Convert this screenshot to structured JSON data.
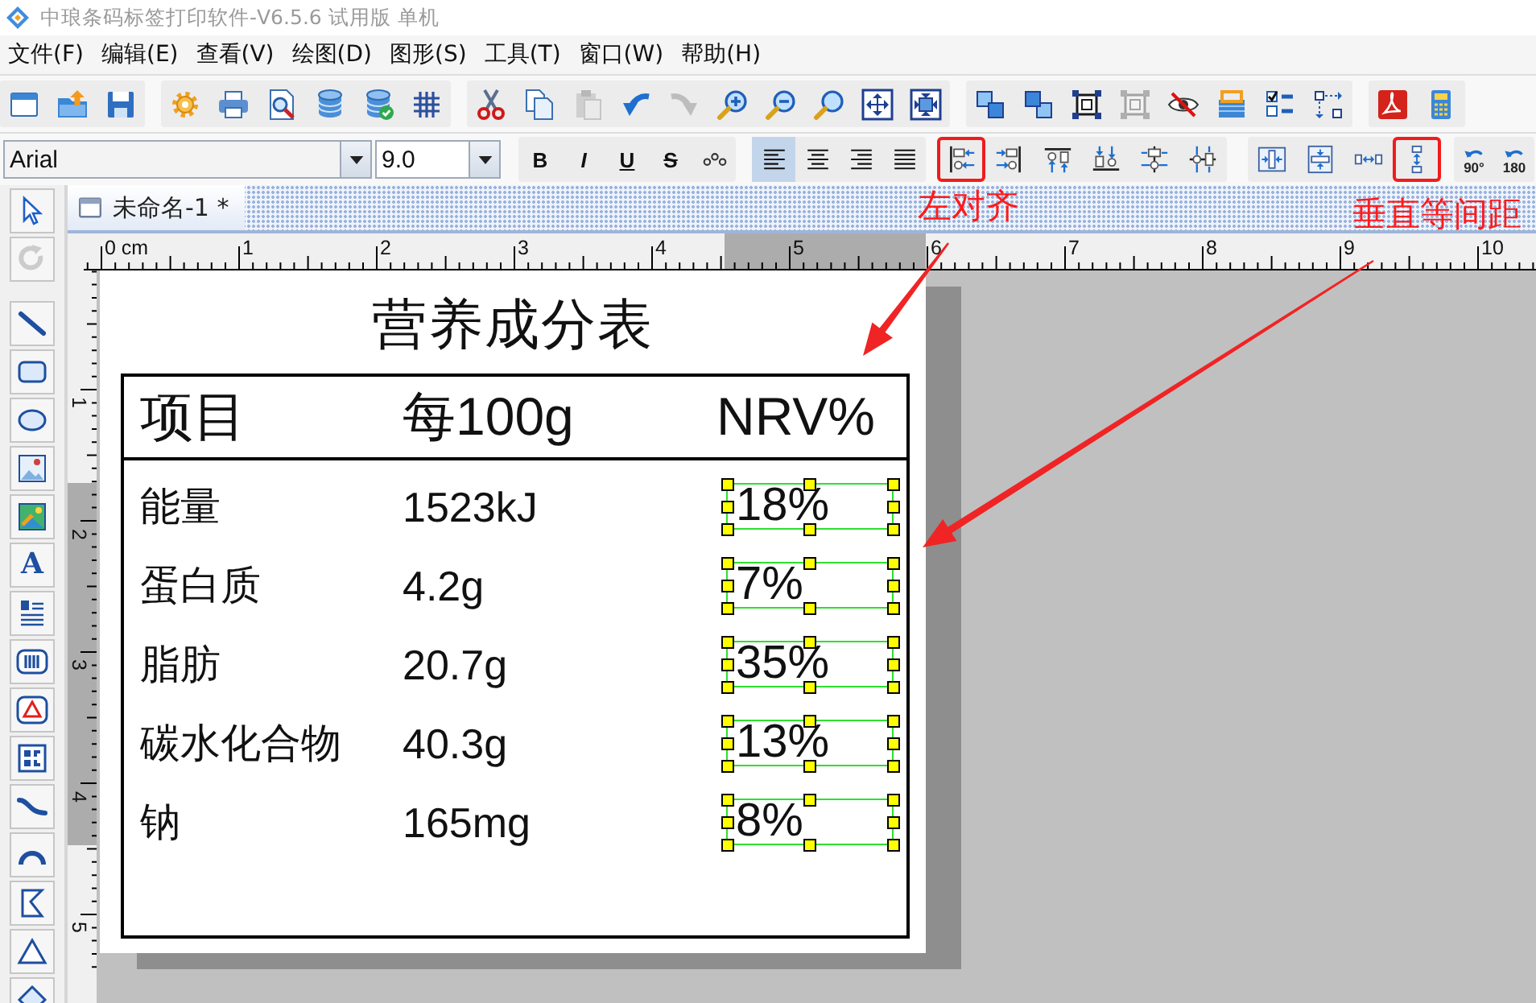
{
  "window": {
    "title": "中琅条码标签打印软件-V6.5.6 试用版 单机"
  },
  "menu": [
    "文件(F)",
    "编辑(E)",
    "查看(V)",
    "绘图(D)",
    "图形(S)",
    "工具(T)",
    "窗口(W)",
    "帮助(H)"
  ],
  "main_toolbar": {
    "groups": [
      [
        {
          "disabled": false
        },
        {
          "disabled": false
        },
        {
          "disabled": false
        }
      ],
      [
        {
          "disabled": false
        },
        {
          "disabled": false
        },
        {
          "disabled": false
        },
        {
          "disabled": false
        },
        {
          "disabled": false
        },
        {
          "disabled": false
        }
      ],
      [
        {
          "disabled": false
        },
        {
          "disabled": false
        },
        {
          "disabled": true
        },
        {
          "disabled": false
        },
        {
          "disabled": true
        },
        {
          "disabled": false
        },
        {
          "disabled": false
        },
        {
          "disabled": false
        },
        {
          "disabled": false
        },
        {
          "disabled": false
        }
      ],
      [
        {
          "disabled": false
        },
        {
          "disabled": false
        },
        {
          "disabled": false
        },
        {
          "disabled": true
        },
        {
          "disabled": false
        },
        {
          "disabled": false
        },
        {
          "disabled": false
        },
        {
          "disabled": false
        }
      ],
      [
        {
          "disabled": false
        },
        {
          "disabled": false
        }
      ]
    ]
  },
  "format_toolbar": {
    "font": "Arial",
    "font_size": "9.0",
    "text_styles": [
      "B",
      "I",
      "U",
      "S"
    ],
    "text_align": [
      {
        "selected": true
      },
      {
        "selected": false
      },
      {
        "selected": false
      },
      {
        "selected": false
      }
    ],
    "align_objects": [
      {
        "highlighted": true
      },
      {
        "highlighted": false
      },
      {
        "highlighted": false
      },
      {
        "highlighted": false
      },
      {
        "highlighted": false
      },
      {
        "highlighted": false
      }
    ],
    "spacing": [
      {
        "highlighted": false
      },
      {
        "highlighted": false
      },
      {
        "highlighted": false
      },
      {
        "highlighted": true
      }
    ],
    "rotate": [
      {
        "label": "90°"
      },
      {
        "label": "180"
      }
    ]
  },
  "tools": [
    {
      "disabled": false
    },
    {
      "disabled": true
    },
    {
      "disabled": false
    },
    {
      "disabled": false
    },
    {
      "disabled": false
    },
    {
      "disabled": false
    },
    {
      "disabled": false
    },
    {
      "label": "A",
      "disabled": false
    },
    {
      "disabled": false
    },
    {
      "disabled": false
    },
    {
      "disabled": false
    },
    {
      "disabled": false
    },
    {
      "disabled": false
    },
    {
      "disabled": false
    },
    {
      "disabled": false
    },
    {
      "disabled": false
    },
    {
      "disabled": false
    }
  ],
  "document": {
    "tab": "未命名-1 *",
    "rulers": {
      "horizontal": [
        "0 cm",
        "1",
        "2",
        "3",
        "4",
        "5",
        "6",
        "7",
        "8",
        "9",
        "10"
      ],
      "vertical": [
        "1",
        "2",
        "3",
        "4",
        "5"
      ]
    },
    "label": {
      "title": "营养成分表",
      "columns": [
        "项目",
        "每100g",
        "NRV%"
      ],
      "rows": [
        {
          "item": "能量",
          "amount": "1523kJ",
          "nrv": "18%",
          "nrv_selected": true
        },
        {
          "item": "蛋白质",
          "amount": "4.2g",
          "nrv": "7%",
          "nrv_selected": true
        },
        {
          "item": "脂肪",
          "amount": "20.7g",
          "nrv": "35%",
          "nrv_selected": true
        },
        {
          "item": "碳水化合物",
          "amount": "40.3g",
          "nrv": "13%",
          "nrv_selected": true
        },
        {
          "item": "钠",
          "amount": "165mg",
          "nrv": "8%",
          "nrv_selected": true
        }
      ]
    }
  },
  "annotations": [
    {
      "text": "左对齐"
    },
    {
      "text": "垂直等间距"
    }
  ]
}
